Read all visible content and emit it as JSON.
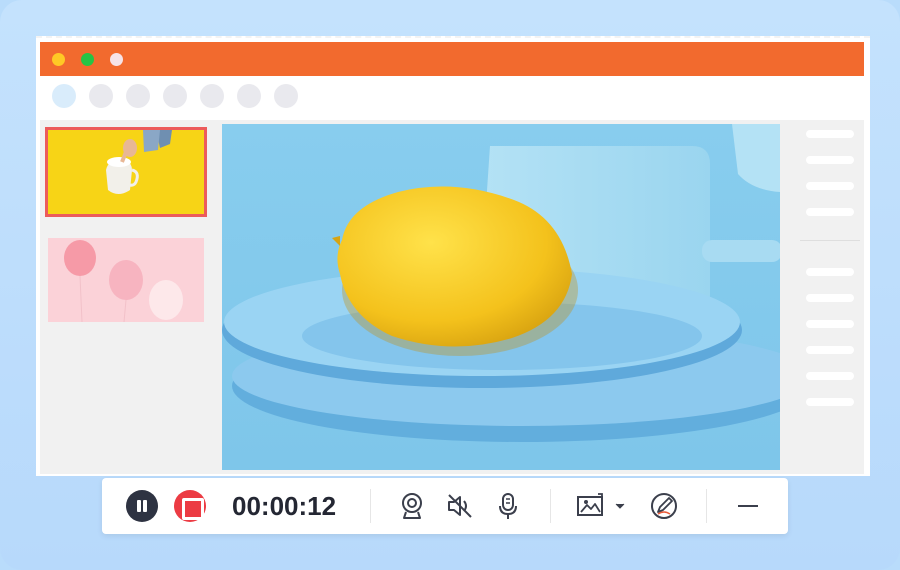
{
  "window": {
    "title_dots": [
      "close-dot",
      "maximize-dot",
      "minimize-dot"
    ],
    "toolbar_icon_count": 7
  },
  "slides": [
    {
      "name": "slide-1",
      "selected": true
    },
    {
      "name": "slide-2",
      "selected": false
    }
  ],
  "recorder": {
    "timer": "00:00:12",
    "pause_icon": "pause-icon",
    "stop_icon": "stop-icon",
    "webcam_icon": "webcam-icon",
    "speaker_icon": "speaker-muted-icon",
    "mic_icon": "microphone-icon",
    "screenshot_icon": "image-capture-icon",
    "annotate_icon": "annotate-pen-icon",
    "minimize_icon": "minimize-icon"
  },
  "colors": {
    "accent": "#f26a2e",
    "stop": "#ec3b43",
    "pause": "#2e3342",
    "selection": "#ec5b5b"
  }
}
